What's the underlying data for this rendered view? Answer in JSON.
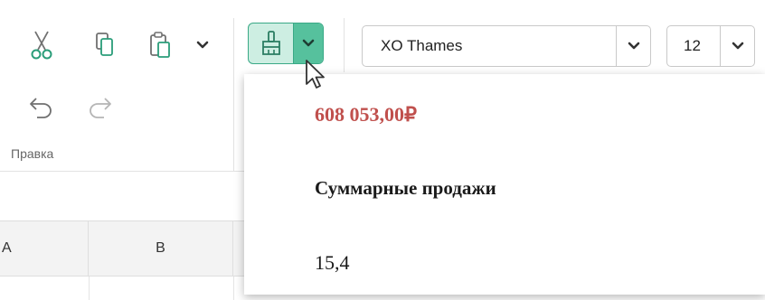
{
  "toolbar": {
    "edit_group": {
      "label": "Правка",
      "buttons": [
        {
          "name": "cut",
          "icon": "scissors-icon"
        },
        {
          "name": "copy",
          "icon": "copy-icon"
        },
        {
          "name": "paste",
          "icon": "clipboard-icon"
        },
        {
          "name": "paste-options",
          "icon": "chevron-down-icon"
        },
        {
          "name": "undo",
          "icon": "undo-icon"
        },
        {
          "name": "redo",
          "icon": "redo-icon"
        }
      ]
    },
    "format_painter": {
      "icon": "paintbrush-icon",
      "dropdown_icon": "chevron-down-icon",
      "active": true
    },
    "font": {
      "value": "XO Thames"
    },
    "font_size": {
      "value": "12"
    }
  },
  "grid": {
    "columns": [
      "A",
      "B"
    ]
  },
  "painter_dropdown": {
    "items": [
      {
        "label": "608 053,00₽",
        "style": "bold-red"
      },
      {
        "label": "Суммарные продажи",
        "style": "bold"
      },
      {
        "label": "15,4",
        "style": "regular"
      }
    ]
  },
  "colors": {
    "accent_green": "#3aa986",
    "accent_green_light": "#cdeee2",
    "icon_green": "#2a9d79",
    "icon_gray": "#707070",
    "value_red": "#c0504d"
  }
}
